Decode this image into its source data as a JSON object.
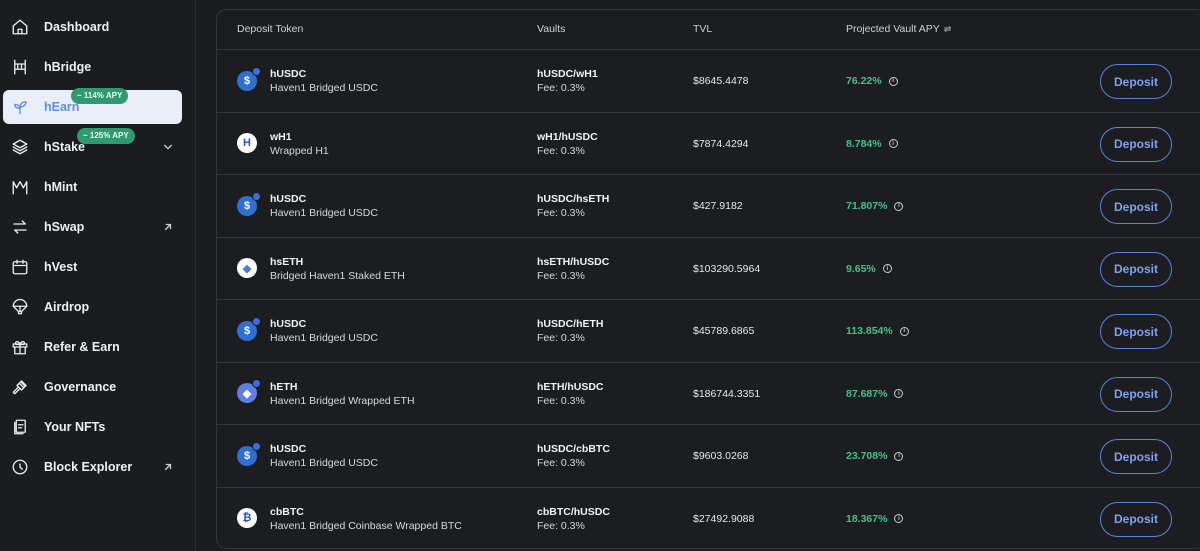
{
  "sidebar": {
    "items": [
      {
        "label": "Dashboard",
        "icon": "home-icon"
      },
      {
        "label": "hBridge",
        "icon": "bridge-icon"
      },
      {
        "label": "hEarn",
        "icon": "sprout-icon",
        "badge": "~ 114% APY",
        "active": true
      },
      {
        "label": "hStake",
        "icon": "layers-icon",
        "badge": "~ 125% APY",
        "suffix": "chevron-down-icon"
      },
      {
        "label": "hMint",
        "icon": "mint-icon"
      },
      {
        "label": "hSwap",
        "icon": "swap-icon",
        "suffix": "external-link-icon"
      },
      {
        "label": "hVest",
        "icon": "calendar-icon"
      },
      {
        "label": "Airdrop",
        "icon": "parachute-icon"
      },
      {
        "label": "Refer & Earn",
        "icon": "gift-icon"
      },
      {
        "label": "Governance",
        "icon": "gavel-icon"
      },
      {
        "label": "Your NFTs",
        "icon": "nft-icon"
      },
      {
        "label": "Block Explorer",
        "icon": "explorer-icon",
        "suffix": "external-link-icon"
      }
    ]
  },
  "table": {
    "headers": {
      "token": "Deposit Token",
      "vaults": "Vaults",
      "tvl": "TVL",
      "apy": "Projected Vault APY",
      "apy_sort_icon": "⇌"
    },
    "rows": [
      {
        "symbol": "hUSDC",
        "name": "Haven1 Bridged USDC",
        "icon": "usdc-icon",
        "pair": "hUSDC/wH1",
        "fee": "Fee: 0.3%",
        "tvl": "$8645.4478",
        "apy": "76.22%",
        "action": "Deposit"
      },
      {
        "symbol": "wH1",
        "name": "Wrapped H1",
        "icon": "h1-icon",
        "pair": "wH1/hUSDC",
        "fee": "Fee: 0.3%",
        "tvl": "$7874.4294",
        "apy": "8.784%",
        "action": "Deposit"
      },
      {
        "symbol": "hUSDC",
        "name": "Haven1 Bridged USDC",
        "icon": "usdc-icon",
        "pair": "hUSDC/hsETH",
        "fee": "Fee: 0.3%",
        "tvl": "$427.9182",
        "apy": "71.807%",
        "action": "Deposit"
      },
      {
        "symbol": "hsETH",
        "name": "Bridged Haven1 Staked ETH",
        "icon": "steth-icon",
        "pair": "hsETH/hUSDC",
        "fee": "Fee: 0.3%",
        "tvl": "$103290.5964",
        "apy": "9.65%",
        "action": "Deposit"
      },
      {
        "symbol": "hUSDC",
        "name": "Haven1 Bridged USDC",
        "icon": "usdc-icon",
        "pair": "hUSDC/hETH",
        "fee": "Fee: 0.3%",
        "tvl": "$45789.6865",
        "apy": "113.854%",
        "action": "Deposit"
      },
      {
        "symbol": "hETH",
        "name": "Haven1 Bridged Wrapped ETH",
        "icon": "eth-icon",
        "pair": "hETH/hUSDC",
        "fee": "Fee: 0.3%",
        "tvl": "$186744.3351",
        "apy": "87.687%",
        "action": "Deposit"
      },
      {
        "symbol": "hUSDC",
        "name": "Haven1 Bridged USDC",
        "icon": "usdc-icon",
        "pair": "hUSDC/cbBTC",
        "fee": "Fee: 0.3%",
        "tvl": "$9603.0268",
        "apy": "23.708%",
        "action": "Deposit"
      },
      {
        "symbol": "cbBTC",
        "name": "Haven1 Bridged Coinbase Wrapped BTC",
        "icon": "btc-icon",
        "pair": "cbBTC/hUSDC",
        "fee": "Fee: 0.3%",
        "tvl": "$27492.9088",
        "apy": "18.367%",
        "action": "Deposit"
      }
    ]
  },
  "colors": {
    "background": "#1b1c1f",
    "accent": "#5e8fe6",
    "apy_green": "#46c08a",
    "badge_green": "#2f9a6f"
  }
}
